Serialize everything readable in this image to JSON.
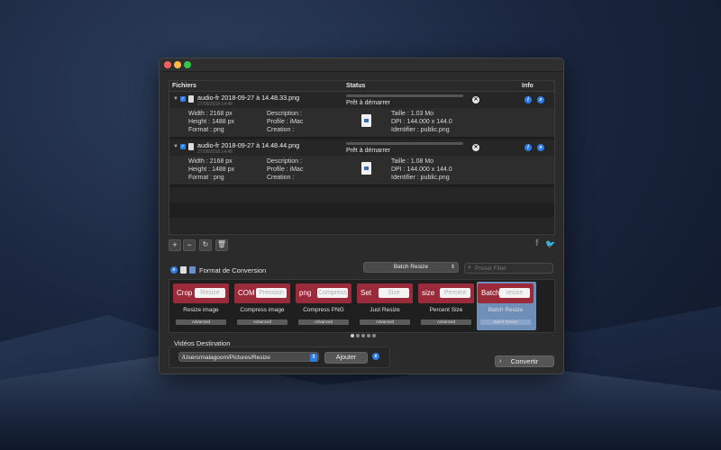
{
  "columns": {
    "files": "Fichiers",
    "status": "Status",
    "info": "Info"
  },
  "files": [
    {
      "name": "audio-fr 2018-09-27 à 14.48.33.png",
      "date": "27/09/2018 14:48",
      "status": "Prêt à démarrer",
      "width": "Width : 2168 px",
      "height": "Height : 1488 px",
      "format": "Format : png",
      "description": "Description :",
      "profile": "Profile : iMac",
      "creation": "Creation :",
      "size": "Taille : 1.03 Mo",
      "dpi": "DPI : 144.000 x 144.0",
      "identifier": "Identifier : public.png"
    },
    {
      "name": "audio-fr 2018-09-27 à 14.48.44.png",
      "date": "27/09/2018 14:48",
      "status": "Prêt à démarrer",
      "width": "Width : 2168 px",
      "height": "Height : 1488 px",
      "format": "Format : png",
      "description": "Description :",
      "profile": "Profile : iMac",
      "creation": "Creation :",
      "size": "Taille : 1.08 Mo",
      "dpi": "DPI : 144.000 x 144.0",
      "identifier": "Identifier : public.png"
    }
  ],
  "format_section": {
    "title": "Format de Conversion",
    "selected_preset": "Batch Resize",
    "filter_placeholder": "Preset Filter"
  },
  "presets": [
    {
      "code": "Crop",
      "field": "Resize",
      "label": "Resize image",
      "adv": "Advanced"
    },
    {
      "code": "COM",
      "field": "Pression",
      "label": "Compress image",
      "adv": "Advanced"
    },
    {
      "code": "png",
      "field": "Compress",
      "label": "Compress PNG",
      "adv": "Advanced"
    },
    {
      "code": "Set",
      "field": "Size",
      "label": "Just Resize",
      "adv": "Advanced"
    },
    {
      "code": "size",
      "field": "Percent",
      "label": "Percent Size",
      "adv": "Advanced"
    },
    {
      "code": "Batch",
      "field": "resize",
      "label": "Batch Resize",
      "adv": "Batch Resize"
    }
  ],
  "destination": {
    "title": "Vidéos Destination",
    "path": "/Users/malagoom/Pictures/Resize",
    "add_label": "Ajouter"
  },
  "convert_label": "Convertir",
  "colors": {
    "accent": "#2f7be6",
    "preset_red": "#9b2b3a",
    "selected_card": "#6f8fb8"
  }
}
